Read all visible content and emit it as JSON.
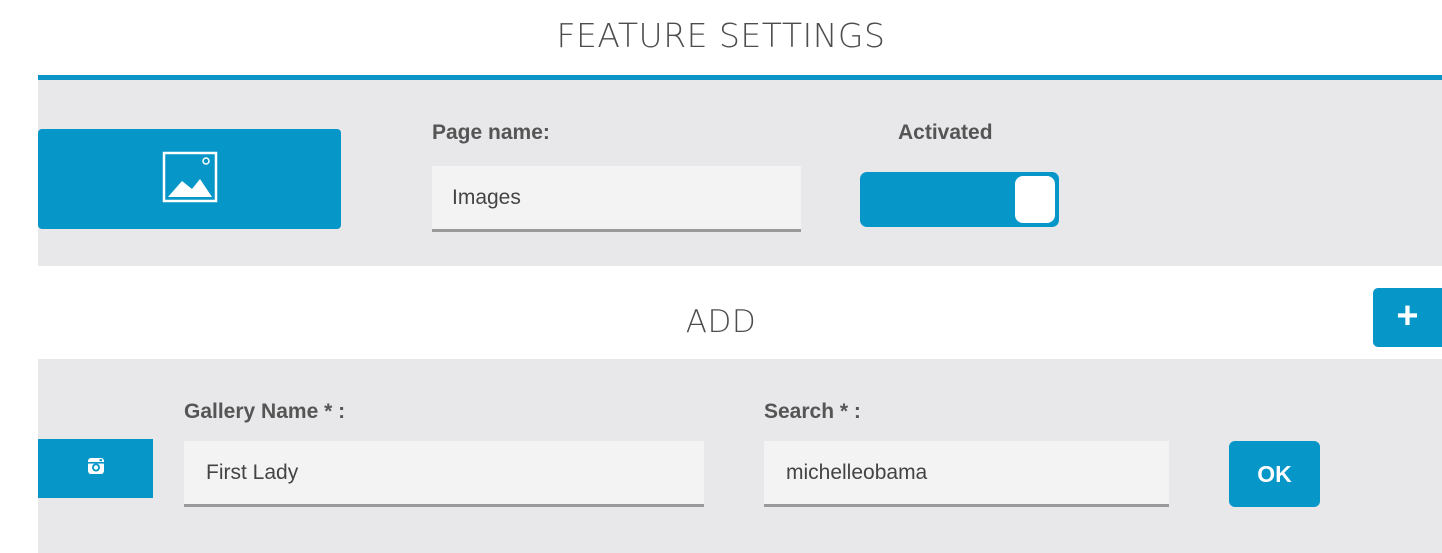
{
  "feature_settings": {
    "title": "FEATURE SETTINGS",
    "page_name_label": "Page name:",
    "page_name_value": "Images",
    "activated_label": "Activated",
    "activated": true,
    "image_button_icon": "image-icon"
  },
  "add_section": {
    "title": "ADD",
    "add_button_label": "+"
  },
  "gallery": {
    "gallery_name_label": "Gallery Name * :",
    "gallery_name_value": "First Lady",
    "search_label": "Search * :",
    "search_value": "michelleobama",
    "ok_label": "OK",
    "source_icon": "instagram-icon"
  },
  "colors": {
    "accent": "#0796c8",
    "panel_bg": "#e8e8ea",
    "input_bg": "#f3f3f3"
  }
}
